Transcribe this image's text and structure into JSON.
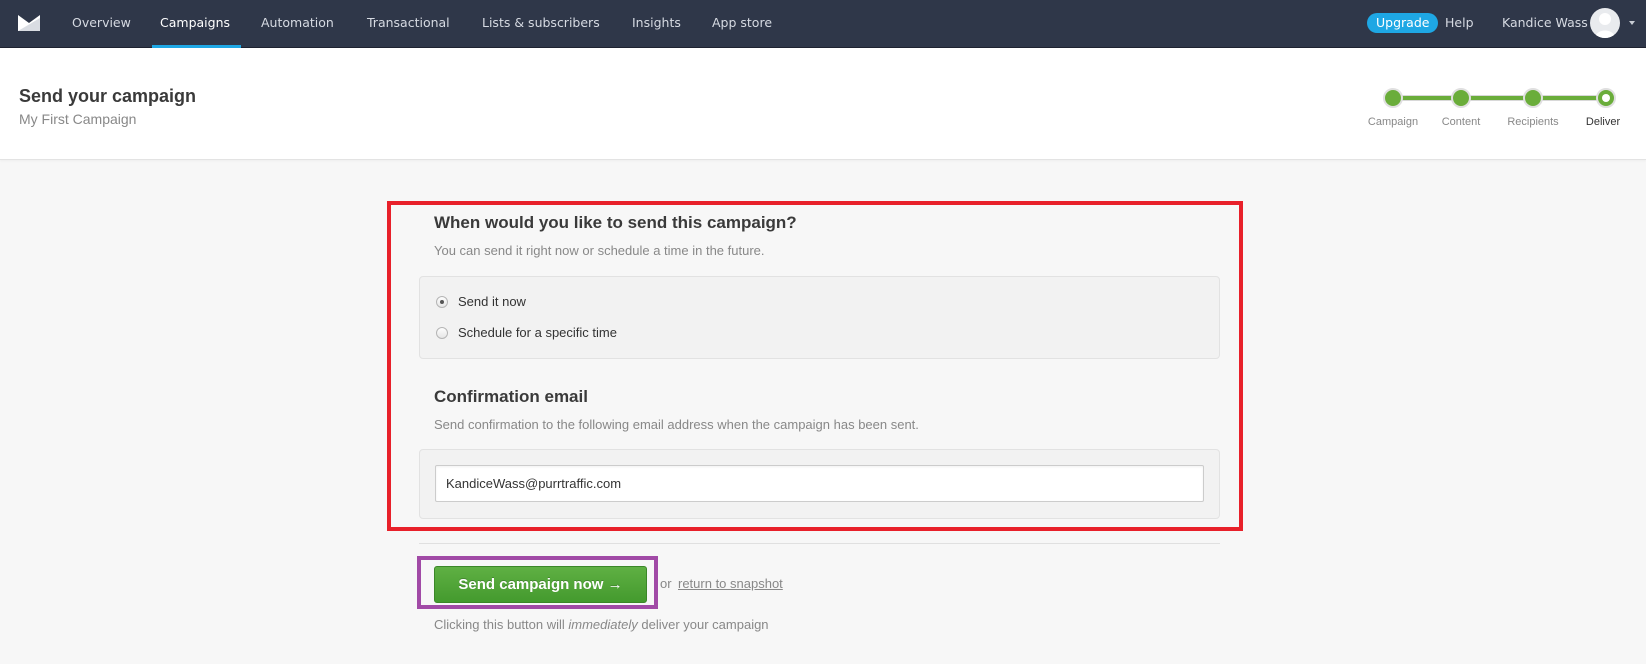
{
  "topnav": {
    "logo_icon": "mailer-envelope-logo",
    "items": [
      {
        "label": "Overview",
        "active": false
      },
      {
        "label": "Campaigns",
        "active": true
      },
      {
        "label": "Automation",
        "active": false
      },
      {
        "label": "Transactional",
        "active": false
      },
      {
        "label": "Lists & subscribers",
        "active": false
      },
      {
        "label": "Insights",
        "active": false
      },
      {
        "label": "App store",
        "active": false
      }
    ],
    "upgrade_label": "Upgrade",
    "help_label": "Help",
    "user_name": "Kandice Wass"
  },
  "header": {
    "title": "Send your campaign",
    "subtitle": "My First Campaign"
  },
  "stepper": {
    "steps": [
      {
        "label": "Campaign",
        "state": "done"
      },
      {
        "label": "Content",
        "state": "done"
      },
      {
        "label": "Recipients",
        "state": "done"
      },
      {
        "label": "Deliver",
        "state": "current"
      }
    ]
  },
  "schedule": {
    "title": "When would you like to send this campaign?",
    "description": "You can send it right now or schedule a time in the future.",
    "options": [
      {
        "label": "Send it now",
        "checked": true
      },
      {
        "label": "Schedule for a specific time",
        "checked": false
      }
    ]
  },
  "confirmation": {
    "title": "Confirmation email",
    "description": "Send confirmation to the following email address when the campaign has been sent.",
    "email_value": "KandiceWass@purrtraffic.com"
  },
  "actions": {
    "send_label": "Send campaign now →",
    "or_text": "or",
    "return_link": "return to snapshot",
    "note_prefix": "Clicking this button will ",
    "note_emphasis": "immediately",
    "note_suffix": " deliver your campaign"
  },
  "colors": {
    "nav_bg": "#2f3749",
    "accent_blue": "#1ea7e4",
    "success_green": "#4ea536",
    "annotation_red": "#e8202a",
    "annotation_purple": "#a14aa6"
  }
}
